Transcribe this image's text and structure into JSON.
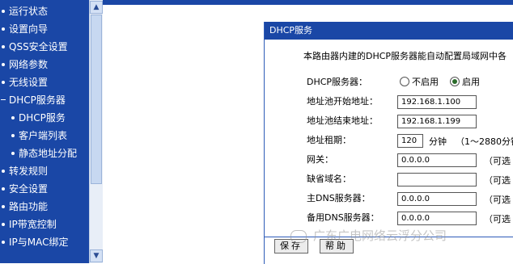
{
  "sidebar": {
    "items": [
      {
        "label": "运行状态"
      },
      {
        "label": "设置向导"
      },
      {
        "label": "QSS安全设置"
      },
      {
        "label": "网络参数"
      },
      {
        "label": "无线设置"
      },
      {
        "label": "DHCP服务器"
      },
      {
        "label": "DHCP服务"
      },
      {
        "label": "客户端列表"
      },
      {
        "label": "静态地址分配"
      },
      {
        "label": "转发规则"
      },
      {
        "label": "安全设置"
      },
      {
        "label": "路由功能"
      },
      {
        "label": "IP带宽控制"
      },
      {
        "label": "IP与MAC绑定"
      }
    ]
  },
  "scrollbar": {
    "up_icon": "▲",
    "down_icon": "▼"
  },
  "panel": {
    "title": "DHCP服务",
    "intro": "本路由器内建的DHCP服务器能自动配置局域网中各",
    "dhcp_server": {
      "label": "DHCP服务器：",
      "option_off": "不启用",
      "option_on": "启用",
      "selected": "启用"
    },
    "pool_start": {
      "label": "地址池开始地址：",
      "value": "192.168.1.100"
    },
    "pool_end": {
      "label": "地址池结束地址：",
      "value": "192.168.1.199"
    },
    "lease": {
      "label": "地址租期：",
      "value": "120",
      "unit": "分钟",
      "hint": "（1～2880分钟"
    },
    "gateway": {
      "label": "网关：",
      "value": "0.0.0.0",
      "hint": "（可选"
    },
    "domain": {
      "label": "缺省域名：",
      "value": "",
      "hint": "（可选"
    },
    "primary_dns": {
      "label": "主DNS服务器：",
      "value": "0.0.0.0",
      "hint": "（可选"
    },
    "secondary_dns": {
      "label": "备用DNS服务器：",
      "value": "0.0.0.0",
      "hint": "（可选"
    },
    "buttons": {
      "save": "保存",
      "help": "帮助"
    }
  },
  "watermark": "广东广电网络云浮分公司",
  "colors": {
    "nav_bg": "#1a47a6",
    "title_bg": "#1a47a6",
    "text": "#000000"
  }
}
